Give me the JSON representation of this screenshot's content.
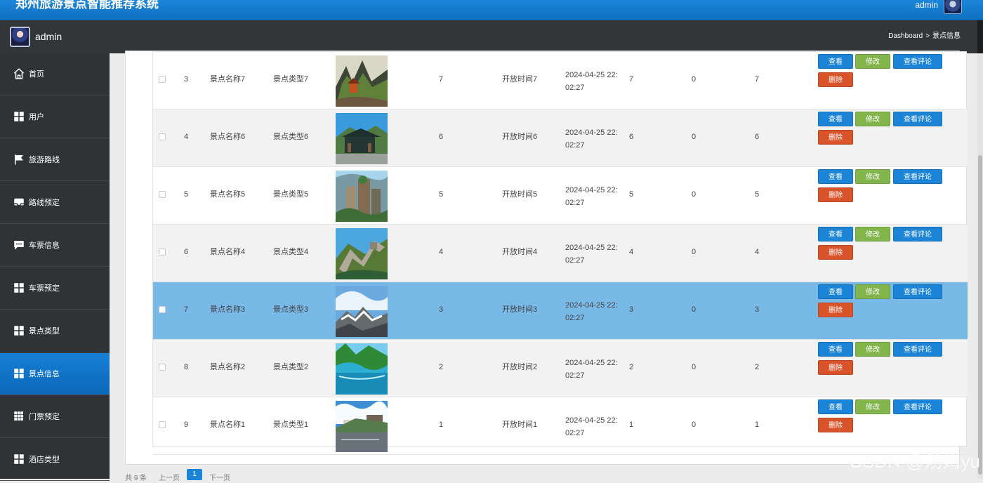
{
  "app": {
    "title": "郑州旅游景点智能推荐系统",
    "user": "admin"
  },
  "header": {
    "user": "admin",
    "breadcrumb": [
      "Dashboard",
      ">",
      "景点信息"
    ]
  },
  "sidebar": {
    "items": [
      {
        "label": "首页",
        "icon": "home-icon",
        "active": false
      },
      {
        "label": "用户",
        "icon": "grid-icon",
        "active": false
      },
      {
        "label": "旅游路线",
        "icon": "flag-icon",
        "active": false
      },
      {
        "label": "路线预定",
        "icon": "inbox-icon",
        "active": false
      },
      {
        "label": "车票信息",
        "icon": "chat-icon",
        "active": false
      },
      {
        "label": "车票预定",
        "icon": "grid-icon",
        "active": false
      },
      {
        "label": "景点类型",
        "icon": "grid-icon",
        "active": false
      },
      {
        "label": "景点信息",
        "icon": "grid-icon",
        "active": true
      },
      {
        "label": "门票预定",
        "icon": "apps-icon",
        "active": false
      },
      {
        "label": "酒店类型",
        "icon": "grid-icon",
        "active": false
      }
    ]
  },
  "table": {
    "rows": [
      {
        "index": "3",
        "name": "景点名称7",
        "type": "景点类型7",
        "count": "7",
        "open_time": "开放时间7",
        "date_line1": "2024-04-25 22:",
        "date_line2": "02:27",
        "value1": "7",
        "value2": "0",
        "value3": "7",
        "image": "mountain-temple",
        "state": "normal"
      },
      {
        "index": "4",
        "name": "景点名称6",
        "type": "景点类型6",
        "count": "6",
        "open_time": "开放时间6",
        "date_line1": "2024-04-25 22:",
        "date_line2": "02:27",
        "value1": "6",
        "value2": "0",
        "value3": "6",
        "image": "pavilion",
        "state": "shade"
      },
      {
        "index": "5",
        "name": "景点名称5",
        "type": "景点类型5",
        "count": "5",
        "open_time": "开放时间5",
        "date_line1": "2024-04-25 22:",
        "date_line2": "02:27",
        "value1": "5",
        "value2": "0",
        "value3": "5",
        "image": "stone-pillars",
        "state": "normal"
      },
      {
        "index": "6",
        "name": "景点名称4",
        "type": "景点类型4",
        "count": "4",
        "open_time": "开放时间4",
        "date_line1": "2024-04-25 22:",
        "date_line2": "02:27",
        "value1": "4",
        "value2": "0",
        "value3": "4",
        "image": "great-wall",
        "state": "shade"
      },
      {
        "index": "7",
        "name": "景点名称3",
        "type": "景点类型3",
        "count": "3",
        "open_time": "开放时间3",
        "date_line1": "2024-04-25 22:",
        "date_line2": "02:27",
        "value1": "3",
        "value2": "0",
        "value3": "3",
        "image": "rocky-peak",
        "state": "selected"
      },
      {
        "index": "8",
        "name": "景点名称2",
        "type": "景点类型2",
        "count": "2",
        "open_time": "开放时间2",
        "date_line1": "2024-04-25 22:",
        "date_line2": "02:27",
        "value1": "2",
        "value2": "0",
        "value3": "2",
        "image": "lake-forest",
        "state": "shade"
      },
      {
        "index": "9",
        "name": "景点名称1",
        "type": "景点类型1",
        "count": "1",
        "open_time": "开放时间1",
        "date_line1": "2024-04-25 22:",
        "date_line2": "02:27",
        "value1": "1",
        "value2": "0",
        "value3": "1",
        "image": "river-town",
        "state": "normal"
      }
    ],
    "actions": {
      "view": "查看",
      "edit": "修改",
      "review": "查看评论",
      "delete": "删除"
    }
  },
  "pagination": {
    "total": "共 9 条",
    "previous": "上一页",
    "current": "1",
    "next": "下一页"
  },
  "watermark": "CSDN @汤姆yu",
  "colors": {
    "topbar": "#1b86d8",
    "sidebar": "#303335",
    "active": "#0c67b8",
    "selected_row": "#78b9e8",
    "view_button": "#1c84d6",
    "edit_button": "#82b54c",
    "delete_button": "#d9532b"
  }
}
